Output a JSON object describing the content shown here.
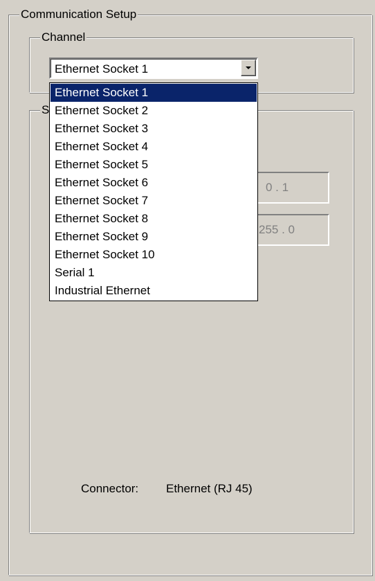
{
  "communication_setup": {
    "title": "Communication Setup"
  },
  "channel": {
    "title": "Channel",
    "selected_value": "Ethernet Socket 1",
    "options": [
      "Ethernet Socket 1",
      "Ethernet Socket 2",
      "Ethernet Socket 3",
      "Ethernet Socket 4",
      "Ethernet Socket 5",
      "Ethernet Socket 6",
      "Ethernet Socket 7",
      "Ethernet Socket 8",
      "Ethernet Socket 9",
      "Ethernet Socket 10",
      "Serial 1",
      "Industrial Ethernet"
    ],
    "highlighted_index": 0
  },
  "settings": {
    "title_visible": "S",
    "ip_tail": "0  .  1",
    "mask_tail": "255  .  0"
  },
  "connector": {
    "label": "Connector:",
    "value": "Ethernet (RJ 45)"
  },
  "colors": {
    "window_bg": "#d4d0c8",
    "selection_bg": "#0a246a",
    "selection_fg": "#ffffff",
    "disabled_text": "#808080"
  }
}
